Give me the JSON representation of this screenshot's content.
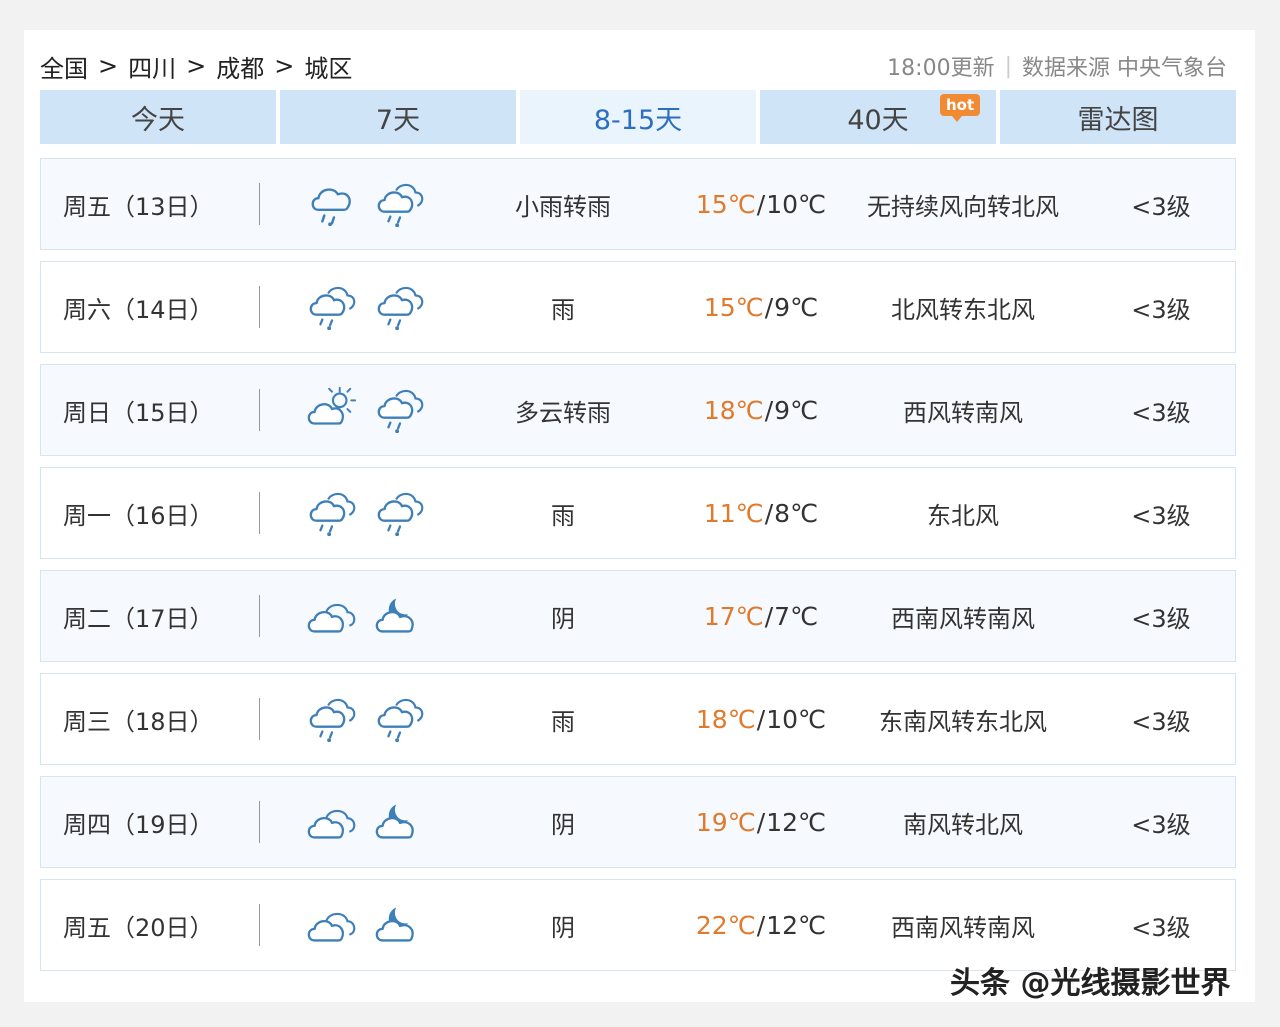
{
  "breadcrumb": {
    "items": [
      "全国",
      "四川",
      "成都",
      "城区"
    ],
    "separator": ">"
  },
  "header_meta": {
    "update_time": "18:00更新",
    "source_label": "数据来源 中央气象台"
  },
  "tabs": [
    {
      "label": "今天",
      "active": false
    },
    {
      "label": "7天",
      "active": false
    },
    {
      "label": "8-15天",
      "active": true
    },
    {
      "label": "40天",
      "active": false,
      "badge": "hot"
    },
    {
      "label": "雷达图",
      "active": false
    }
  ],
  "forecast": [
    {
      "day": "周五（13日）",
      "icons": [
        "cloud-rain-icon",
        "cloud-drizzle-icon"
      ],
      "desc": "小雨转雨",
      "high": "15℃",
      "low": "10℃",
      "wind": "无持续风向转北风",
      "level": "<3级"
    },
    {
      "day": "周六（14日）",
      "icons": [
        "cloud-drizzle-icon",
        "cloud-drizzle-icon"
      ],
      "desc": "雨",
      "high": "15℃",
      "low": "9℃",
      "wind": "北风转东北风",
      "level": "<3级"
    },
    {
      "day": "周日（15日）",
      "icons": [
        "cloud-sun-icon",
        "cloud-drizzle-icon"
      ],
      "desc": "多云转雨",
      "high": "18℃",
      "low": "9℃",
      "wind": "西风转南风",
      "level": "<3级"
    },
    {
      "day": "周一（16日）",
      "icons": [
        "cloud-drizzle-icon",
        "cloud-drizzle-icon"
      ],
      "desc": "雨",
      "high": "11℃",
      "low": "8℃",
      "wind": "东北风",
      "level": "<3级"
    },
    {
      "day": "周二（17日）",
      "icons": [
        "overcast-icon",
        "cloud-moon-icon"
      ],
      "desc": "阴",
      "high": "17℃",
      "low": "7℃",
      "wind": "西南风转南风",
      "level": "<3级"
    },
    {
      "day": "周三（18日）",
      "icons": [
        "cloud-drizzle-icon",
        "cloud-drizzle-icon"
      ],
      "desc": "雨",
      "high": "18℃",
      "low": "10℃",
      "wind": "东南风转东北风",
      "level": "<3级"
    },
    {
      "day": "周四（19日）",
      "icons": [
        "overcast-icon",
        "cloud-moon-icon"
      ],
      "desc": "阴",
      "high": "19℃",
      "low": "12℃",
      "wind": "南风转北风",
      "level": "<3级"
    },
    {
      "day": "周五（20日）",
      "icons": [
        "overcast-icon",
        "cloud-moon-icon"
      ],
      "desc": "阴",
      "high": "22℃",
      "low": "12℃",
      "wind": "西南风转南风",
      "level": "<3级"
    }
  ],
  "colors": {
    "tab_bg": "#cfe4f7",
    "tab_active_text": "#2c6fc0",
    "high_temp": "#e07a2c",
    "icon_stroke": "#3f7fb8",
    "hot_badge": "#f08a33"
  },
  "watermark": "头条 @光线摄影世界"
}
